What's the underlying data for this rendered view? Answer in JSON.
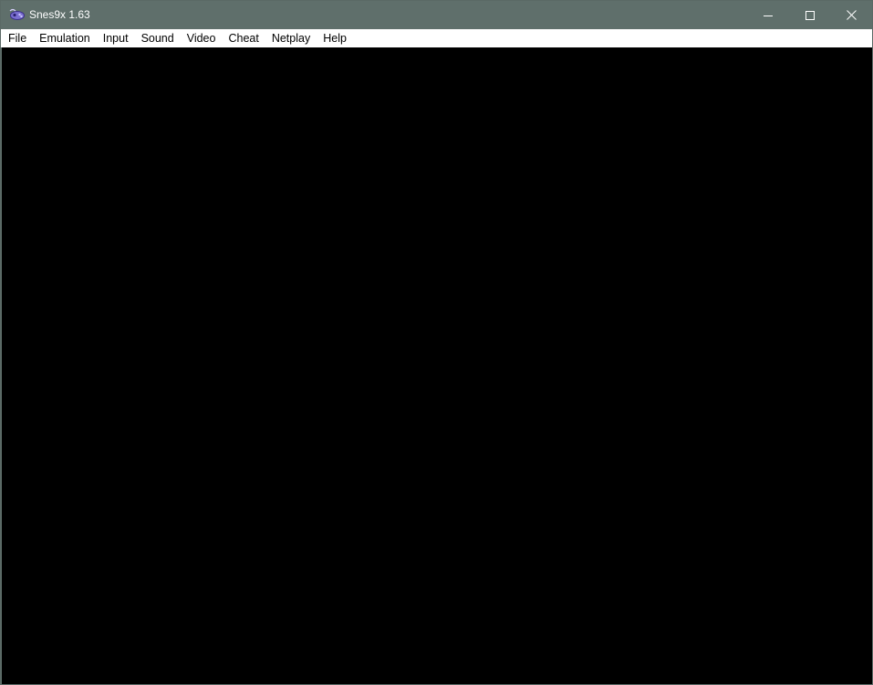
{
  "window": {
    "title": "Snes9x 1.63",
    "icon": "snes9x-app-icon",
    "titlebar_color": "#5f6f6b",
    "caption_buttons": {
      "minimize": "minimize-icon",
      "maximize": "maximize-icon",
      "close": "close-icon"
    }
  },
  "menubar": {
    "items": [
      {
        "label": "File"
      },
      {
        "label": "Emulation"
      },
      {
        "label": "Input"
      },
      {
        "label": "Sound"
      },
      {
        "label": "Video"
      },
      {
        "label": "Cheat"
      },
      {
        "label": "Netplay"
      },
      {
        "label": "Help"
      }
    ]
  },
  "viewport": {
    "background": "#000000"
  }
}
